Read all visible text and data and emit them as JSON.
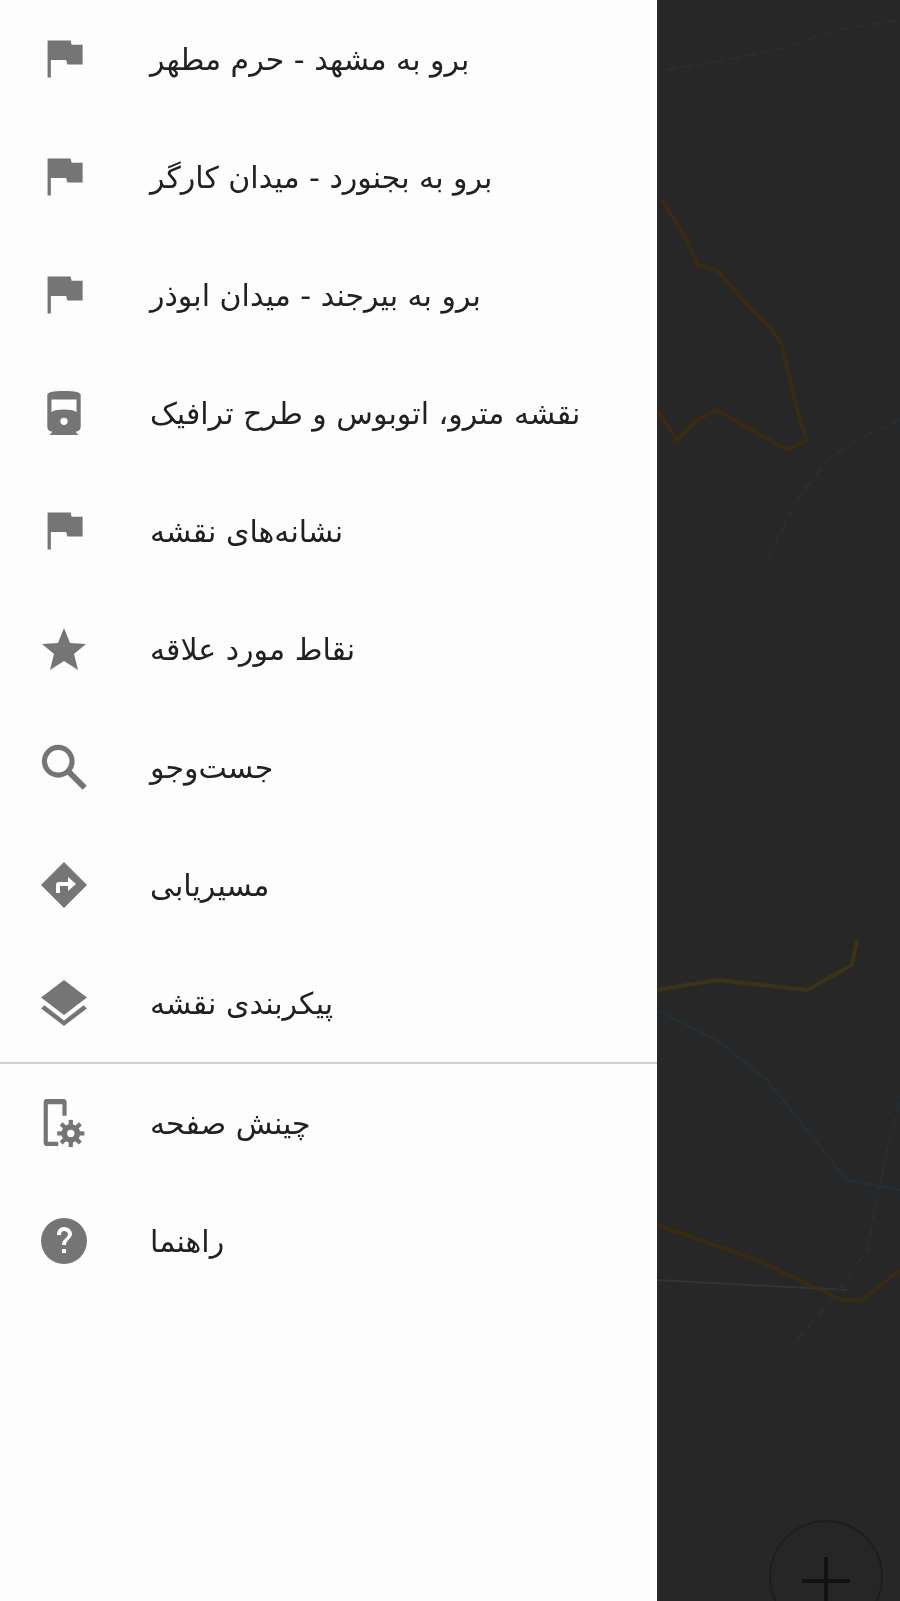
{
  "drawer": {
    "sections": [
      [
        {
          "kind": "flag",
          "label": "برو به مشهد - حرم مطهر"
        },
        {
          "kind": "flag",
          "label": "برو به بجنورد - میدان کارگر"
        },
        {
          "kind": "flag",
          "label": "برو به بیرجند - میدان ابوذر"
        },
        {
          "kind": "train",
          "label": "نقشه مترو، اتوبوس و طرح ترافیک"
        },
        {
          "kind": "flag",
          "label": "نشانه‌های نقشه"
        },
        {
          "kind": "star",
          "label": "نقاط مورد علاقه"
        },
        {
          "kind": "search",
          "label": "جست‌وجو"
        },
        {
          "kind": "directions",
          "label": "مسیریابی"
        },
        {
          "kind": "layers",
          "label": "پیکربندی نقشه"
        }
      ],
      [
        {
          "kind": "settings",
          "label": "چینش صفحه"
        },
        {
          "kind": "help",
          "label": "راهنما"
        }
      ]
    ]
  },
  "map": {
    "kind": "picture",
    "zoom_in": true
  }
}
